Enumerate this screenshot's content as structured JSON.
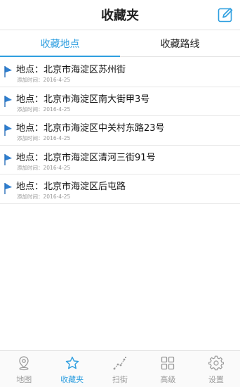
{
  "header": {
    "title": "收藏夹"
  },
  "tabs": [
    {
      "label": "收藏地点",
      "active": true
    },
    {
      "label": "收藏路线",
      "active": false
    }
  ],
  "favorites": [
    {
      "title": "地点：北京市海淀区苏州街",
      "date": "添加时间：2016-4-25"
    },
    {
      "title": "地点：北京市海淀区南大街甲3号",
      "date": "添加时间：2016-4-25"
    },
    {
      "title": "地点：北京市海淀区中关村东路23号",
      "date": "添加时间：2016-4-25"
    },
    {
      "title": "地点：北京市海淀区清河三街91号",
      "date": "添加时间：2016-4-25"
    },
    {
      "title": "地点：北京市海淀区后屯路",
      "date": "添加时间：2016-4-25"
    }
  ],
  "bottom_nav": [
    {
      "label": "地图",
      "icon": "map-pin-icon",
      "active": false
    },
    {
      "label": "收藏夹",
      "icon": "star-icon",
      "active": true
    },
    {
      "label": "扫街",
      "icon": "street-scan-icon",
      "active": false
    },
    {
      "label": "高级",
      "icon": "grid-icon",
      "active": false
    },
    {
      "label": "设置",
      "icon": "gear-icon",
      "active": false
    }
  ],
  "colors": {
    "accent": "#2f9fe0",
    "inactive": "#9a9a9a"
  }
}
